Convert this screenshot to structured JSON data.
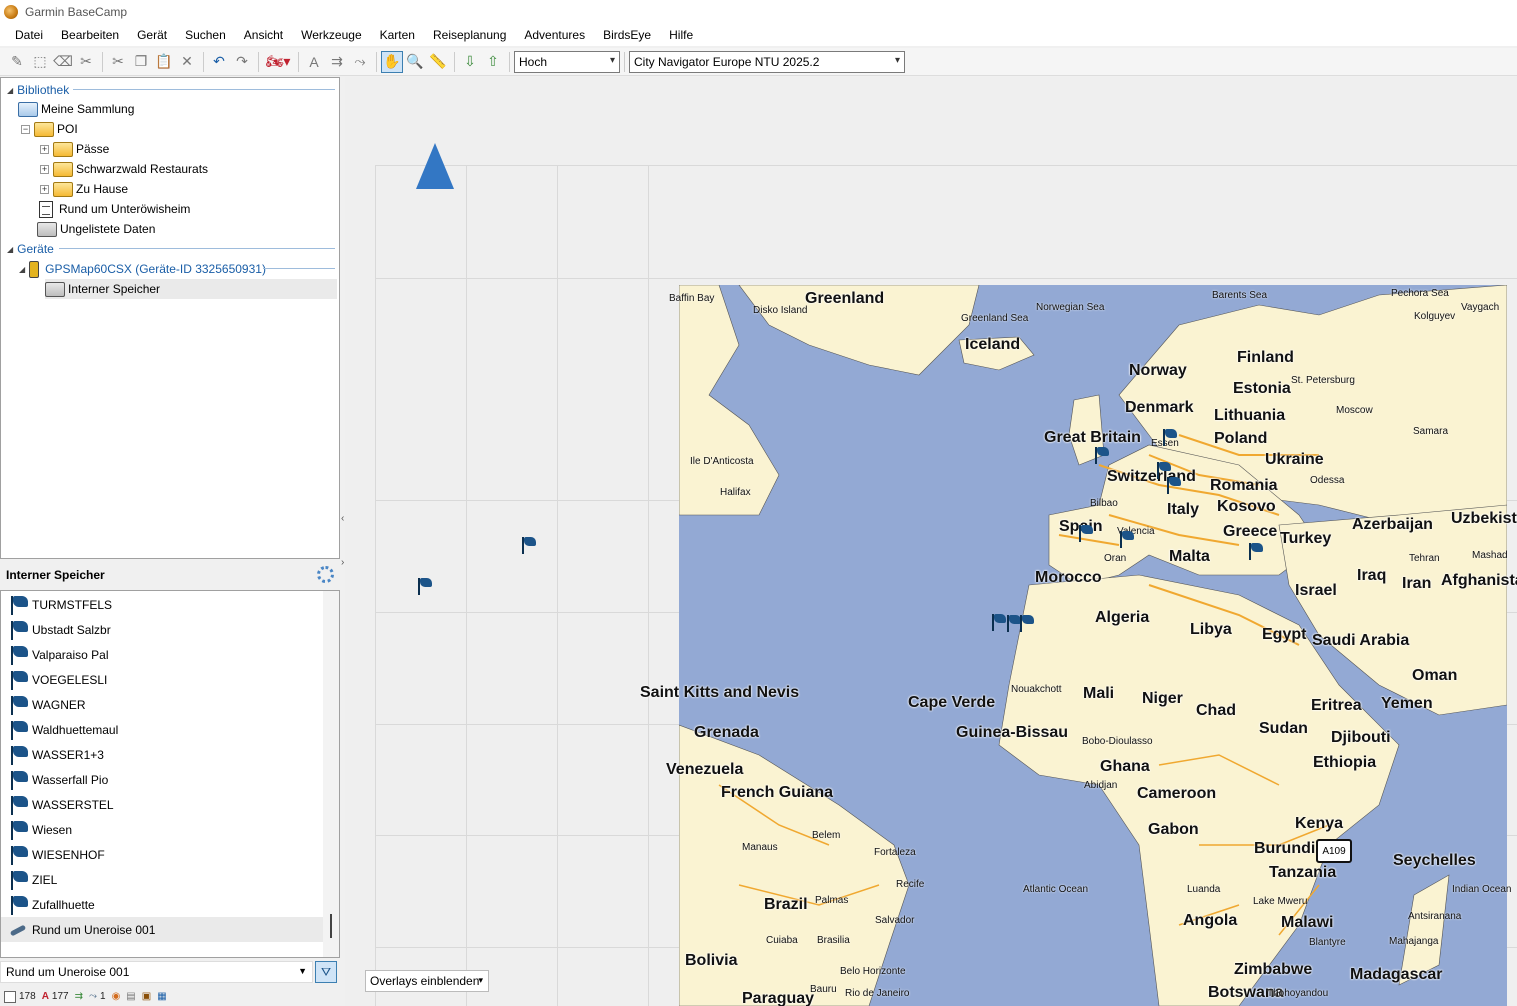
{
  "app": {
    "title": "Garmin BaseCamp"
  },
  "menu": [
    "Datei",
    "Bearbeiten",
    "Gerät",
    "Suchen",
    "Ansicht",
    "Werkzeuge",
    "Karten",
    "Reiseplanung",
    "Adventures",
    "BirdsEye",
    "Hilfe"
  ],
  "toolbar": {
    "orientation": "Hoch",
    "map_product": "City Navigator Europe NTU 2025.2"
  },
  "library": {
    "section_library": "Bibliothek",
    "collection": "Meine Sammlung",
    "poi_folder": "POI",
    "subfolders": [
      "Pässe",
      "Schwarzwald Restaurats",
      "Zu Hause"
    ],
    "route_list": "Rund um Unteröwisheim",
    "unlisted": "Ungelistete Daten",
    "section_devices": "Geräte",
    "device": "GPSMap60CSX (Geräte-ID 3325650931)",
    "internal_memory": "Interner Speicher"
  },
  "list": {
    "header": "Interner Speicher",
    "items": [
      "TURMSTFELS",
      "Ubstadt Salzbr",
      "Valparaiso Pal",
      "VOEGELESLI",
      "WAGNER",
      "Waldhuettemaul",
      "WASSER1+3",
      "Wasserfall Pio",
      "WASSERSTEL",
      "Wiesen",
      "WIESENHOF",
      "ZIEL",
      "Zufallhuette"
    ],
    "route_item": "Rund um Uneroise 001"
  },
  "bottom": {
    "selected": "Rund um Uneroise 001",
    "status": {
      "waypoints": "178",
      "tracks": "177",
      "routes": "1"
    }
  },
  "map": {
    "overlay_label": "Overlays einblenden",
    "road_shield": "A109",
    "labels_big": [
      "Greenland",
      "Iceland",
      "Norway",
      "Finland",
      "Estonia",
      "Denmark",
      "Lithuania",
      "Great Britain",
      "Poland",
      "Ukraine",
      "Switzerland",
      "Romania",
      "Italy",
      "Kosovo",
      "Spain",
      "Greece",
      "Turkey",
      "Azerbaijan",
      "Uzbekistan",
      "Malta",
      "Morocco",
      "Iraq",
      "Iran",
      "Afghanistan",
      "Israel",
      "Algeria",
      "Libya",
      "Egypt",
      "Saudi Arabia",
      "Oman",
      "Saint Kitts and Nevis",
      "Mali",
      "Niger",
      "Chad",
      "Cape Verde",
      "Eritrea",
      "Yemen",
      "Grenada",
      "Guinea-Bissau",
      "Sudan",
      "Djibouti",
      "Venezuela",
      "Ghana",
      "Ethiopia",
      "French Guiana",
      "Cameroon",
      "Gabon",
      "Kenya",
      "Burundi",
      "Seychelles",
      "Tanzania",
      "Brazil",
      "Angola",
      "Malawi",
      "Bolivia",
      "Zimbabwe",
      "Madagascar",
      "Botswana",
      "Paraguay"
    ],
    "labels_small": [
      "Baffin Bay",
      "Disko Island",
      "Greenland Sea",
      "Norwegian Sea",
      "Barents Sea",
      "Pechora Sea",
      "Kolguyev",
      "Vaygach",
      "St. Petersburg",
      "Moscow",
      "Samara",
      "Essen",
      "Odessa",
      "Ile D'Anticosta",
      "Halifax",
      "Bilbao",
      "Valencia",
      "Oran",
      "Tehran",
      "Mashad",
      "Nouakchott",
      "Bobo-Dioulasso",
      "Abidjan",
      "Belem",
      "Manaus",
      "Fortaleza",
      "Recife",
      "Palmas",
      "Salvador",
      "Atlantic Ocean",
      "Luanda",
      "Lake Mweru",
      "Indian Ocean",
      "Antsiranana",
      "Blantyre",
      "Mahajanga",
      "Cuiaba",
      "Brasilia",
      "Belo Horizonte",
      "Bauru",
      "Rio de Janeiro",
      "Thohoyandou"
    ]
  },
  "colors": {
    "accent": "#1a5ea7",
    "water": "#93a9d4",
    "land": "#faf3d2",
    "roads": "#f0a830"
  }
}
